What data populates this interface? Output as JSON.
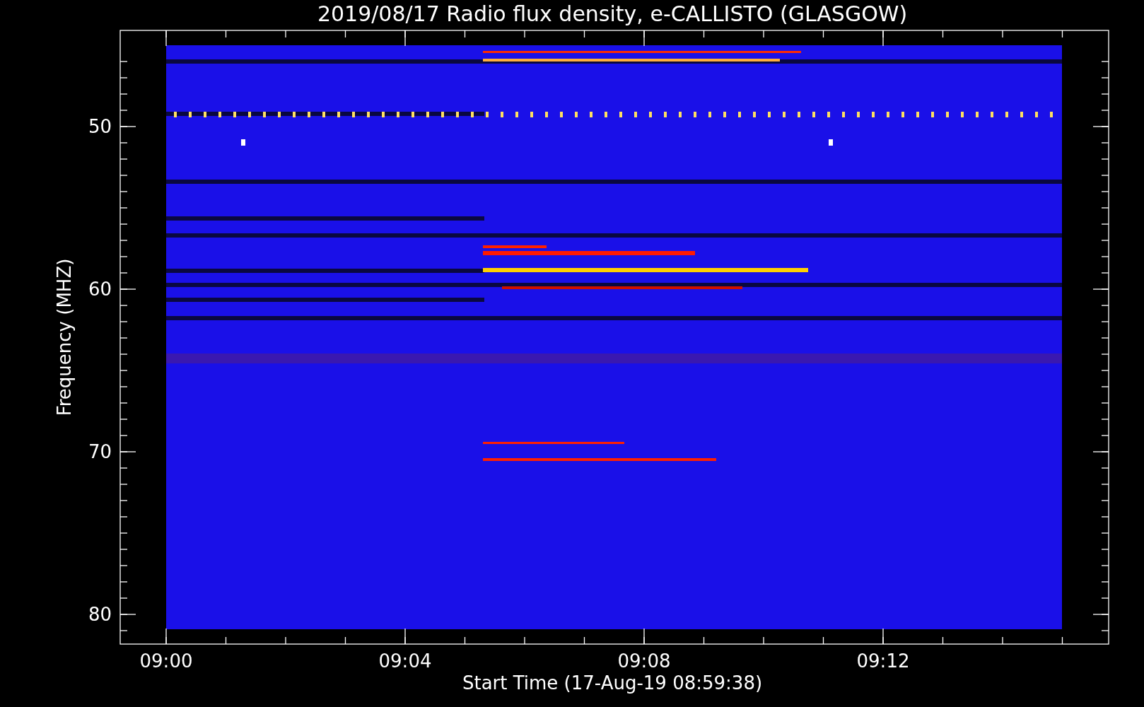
{
  "title": "2019/08/17  Radio flux density, e-CALLISTO (GLASGOW)",
  "y_axis": {
    "label": "Frequency (MHZ)",
    "ticks": [
      "50",
      "60",
      "70",
      "80"
    ]
  },
  "x_axis": {
    "label": "Start Time (17-Aug-19 08:59:38)",
    "ticks": [
      "09:00",
      "09:04",
      "09:08",
      "09:12"
    ]
  }
}
